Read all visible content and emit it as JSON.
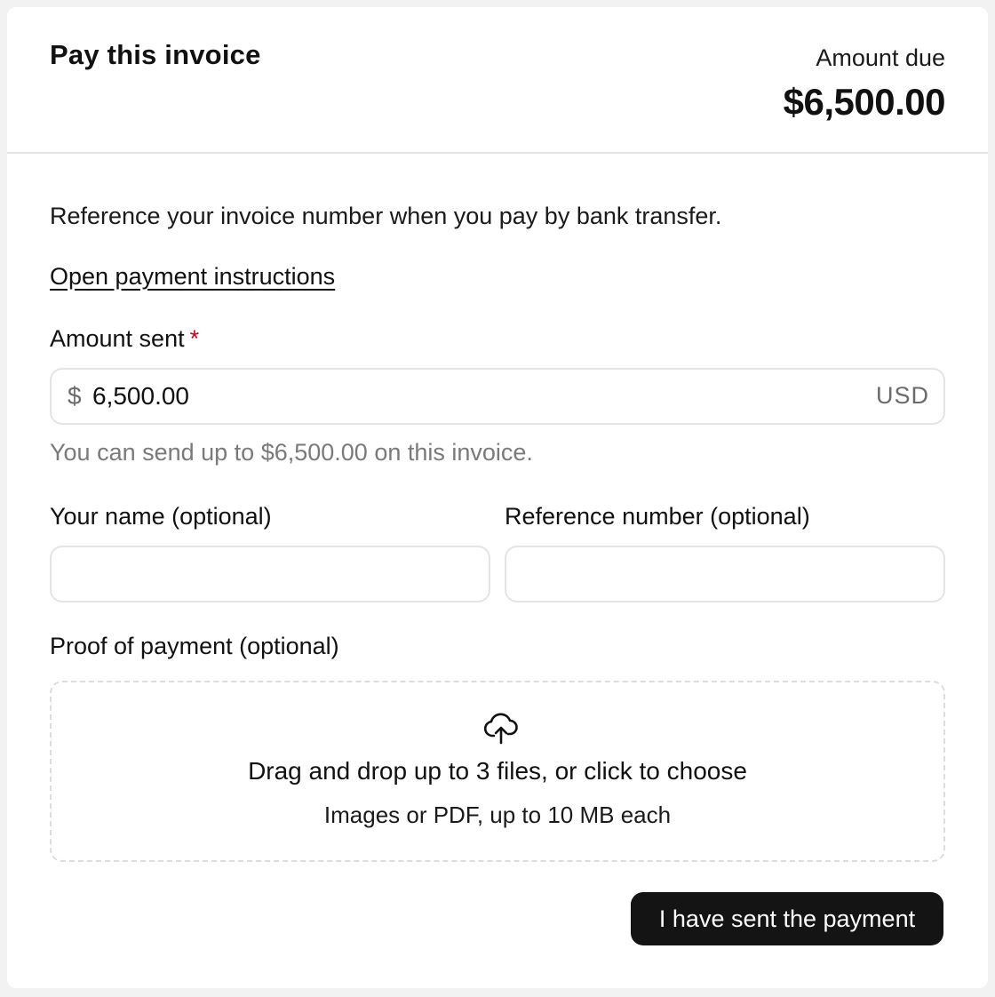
{
  "header": {
    "title": "Pay this invoice",
    "amount_due_label": "Amount due",
    "amount_due_value": "$6,500.00"
  },
  "intro_text": "Reference your invoice number when you pay by bank transfer.",
  "instructions_link": "Open payment instructions",
  "amount_sent": {
    "label": "Amount sent",
    "required_marker": "*",
    "currency_symbol": "$",
    "value": "6,500.00",
    "currency_code": "USD",
    "helper": "You can send up to $6,500.00 on this invoice."
  },
  "name_field": {
    "label": "Your name (optional)",
    "value": ""
  },
  "reference_field": {
    "label": "Reference number (optional)",
    "value": ""
  },
  "proof": {
    "label": "Proof of payment (optional)",
    "icon": "cloud-upload-icon",
    "title": "Drag and drop up to 3 files, or click to choose",
    "subtitle": "Images or PDF, up to 10 MB each"
  },
  "submit_label": "I have sent the payment",
  "colors": {
    "accent": "#141414",
    "required": "#d0021b",
    "muted_text": "#7a7a7a",
    "border": "#e4e4e4"
  }
}
